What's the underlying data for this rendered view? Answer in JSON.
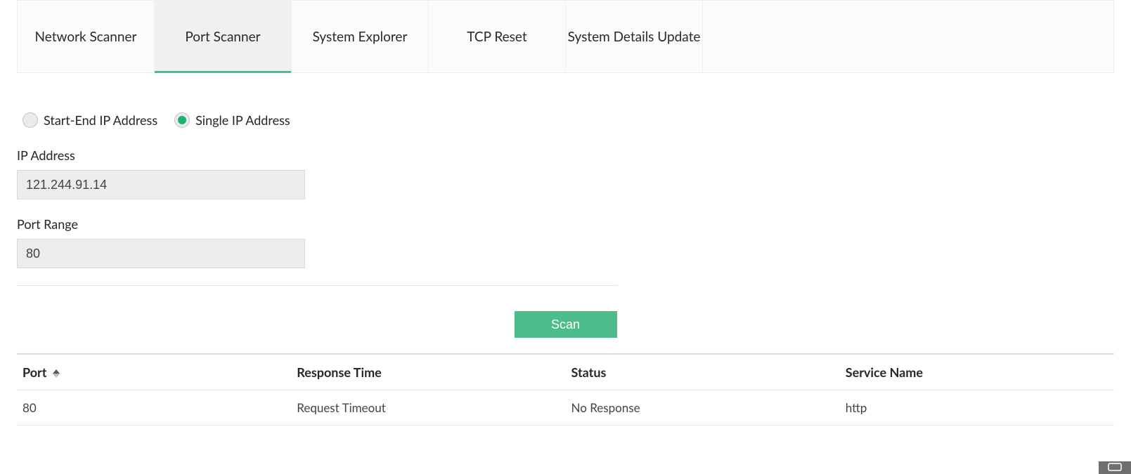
{
  "tabs": [
    {
      "label": "Network Scanner",
      "active": false
    },
    {
      "label": "Port Scanner",
      "active": true
    },
    {
      "label": "System Explorer",
      "active": false
    },
    {
      "label": "TCP Reset",
      "active": false
    },
    {
      "label": "System Details Update",
      "active": false
    }
  ],
  "mode": {
    "options": [
      {
        "label": "Start-End IP Address",
        "selected": false
      },
      {
        "label": "Single IP Address",
        "selected": true
      }
    ]
  },
  "form": {
    "ip_label": "IP Address",
    "ip_value": "121.244.91.14",
    "port_range_label": "Port Range",
    "port_range_value": "80"
  },
  "actions": {
    "scan_label": "Scan"
  },
  "table": {
    "headers": {
      "port": "Port",
      "response_time": "Response Time",
      "status": "Status",
      "service_name": "Service Name"
    },
    "rows": [
      {
        "port": "80",
        "response_time": "Request Timeout",
        "status": "No Response",
        "service_name": "http"
      }
    ]
  }
}
